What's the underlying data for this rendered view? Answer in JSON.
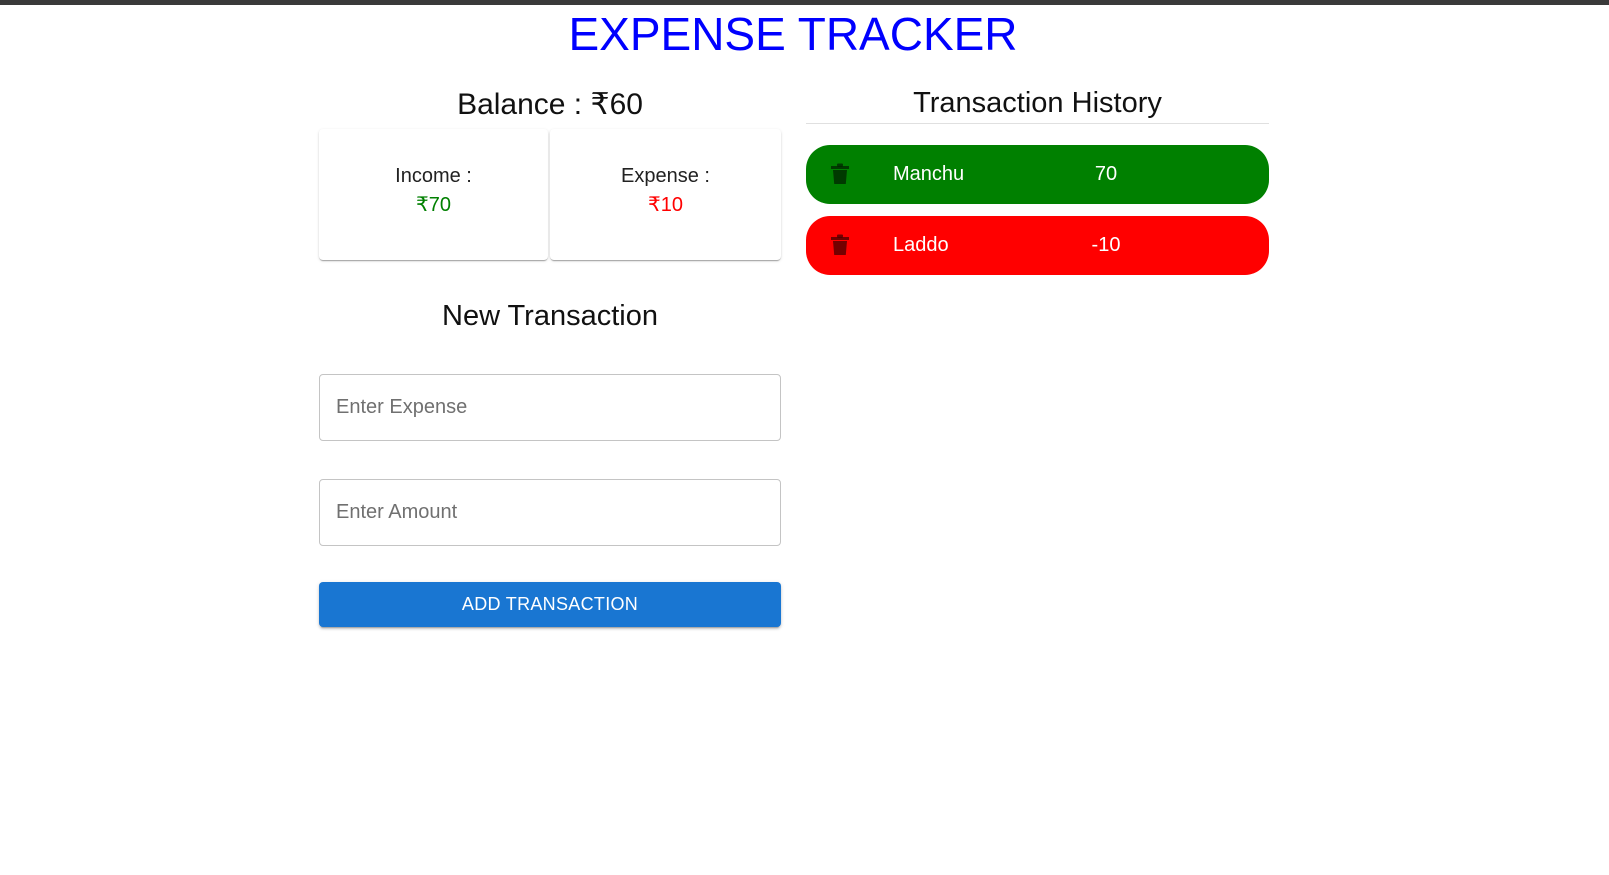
{
  "app": {
    "title": "EXPENSE TRACKER"
  },
  "summary": {
    "balance_text": "Balance : ₹60",
    "income_label": "Income :",
    "income_value": "₹70",
    "expense_label": "Expense :",
    "expense_value": "₹10",
    "income_color": "#008000",
    "expense_color": "#ff0000"
  },
  "new_transaction": {
    "title": "New Transaction",
    "expense_placeholder": "Enter Expense",
    "expense_value": "",
    "amount_placeholder": "Enter Amount",
    "amount_value": "",
    "add_button_label": "ADD TRANSACTION",
    "button_color": "#1976d2"
  },
  "history": {
    "title": "Transaction History",
    "items": [
      {
        "name": "Manchu",
        "amount": "70",
        "color": "#008000",
        "icon": "trash-icon"
      },
      {
        "name": "Laddo",
        "amount": "-10",
        "color": "#ff0000",
        "icon": "trash-icon"
      }
    ]
  }
}
